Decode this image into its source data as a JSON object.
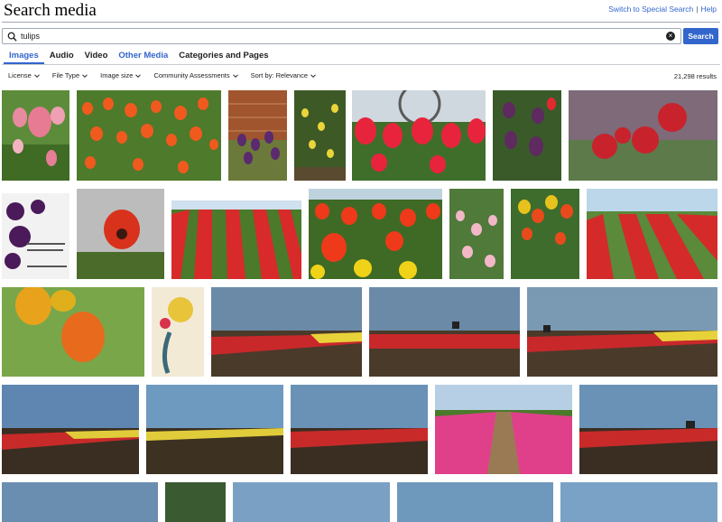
{
  "page": {
    "title": "Search media"
  },
  "toplinks": {
    "special": "Switch to Special Search",
    "sep": "|",
    "help": "Help"
  },
  "search": {
    "value": "tulips",
    "button": "Search"
  },
  "tabs": [
    {
      "label": "Images",
      "active": true
    },
    {
      "label": "Audio"
    },
    {
      "label": "Video"
    },
    {
      "label": "Other Media"
    },
    {
      "label": "Categories and Pages"
    }
  ],
  "filters": [
    {
      "label": "License"
    },
    {
      "label": "File Type"
    },
    {
      "label": "Image size"
    },
    {
      "label": "Community Assessments"
    },
    {
      "label": "Sort by: Relevance"
    }
  ],
  "results_count": "21,298 results",
  "icons": {
    "search": "search-icon",
    "clear": "clear-icon",
    "dropdown": "chevron-down-icon"
  },
  "colors": {
    "accent": "#3366cc",
    "text": "#202122",
    "border": "#a2a9b1"
  }
}
